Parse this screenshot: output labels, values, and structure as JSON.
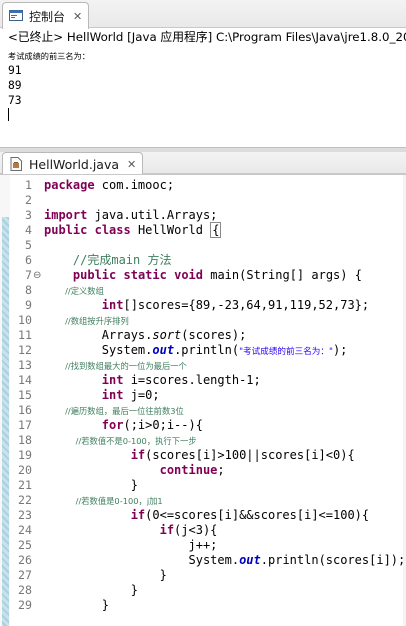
{
  "console": {
    "tab_label": "控制台",
    "tab_close": "✕",
    "status": "<已终止> HellWorld [Java 应用程序] C:\\Program Files\\Java\\jre1.8.0_20",
    "output_header": "考试成绩的前三名为：",
    "output_values": [
      "91",
      "89",
      "73"
    ]
  },
  "editor": {
    "tab_label": "HellWorld.java",
    "tab_close": "✕",
    "line_numbers": [
      "1",
      "2",
      "3",
      "4",
      "5",
      "6",
      "7",
      "8",
      "9",
      "10",
      "11",
      "12",
      "13",
      "14",
      "15",
      "16",
      "17",
      "18",
      "19",
      "20",
      "21",
      "22",
      "23",
      "24",
      "25",
      "26",
      "27",
      "28",
      "29"
    ],
    "fold_marker": "⊖",
    "lines": {
      "l1": [
        "package",
        " com.imooc;"
      ],
      "l3": [
        "import",
        " java.util.Arrays;"
      ],
      "l4": [
        "public",
        " ",
        "class",
        " HellWorld ",
        "{"
      ],
      "l6": [
        "    //完成main 方法"
      ],
      "l7": [
        "    ",
        "public",
        " ",
        "static",
        " ",
        "void",
        " main(String[] args) {"
      ],
      "l8": [
        "        //定义数组"
      ],
      "l9": [
        "        ",
        "int",
        "[]scores={89,-23,64,91,119,52,73};"
      ],
      "l10": [
        "        //数组按升序排列"
      ],
      "l11": [
        "        Arrays.",
        "sort",
        "(scores);"
      ],
      "l12": [
        "        System.",
        "out",
        ".println(",
        "\"考试成绩的前三名为：\"",
        ");"
      ],
      "l13": [
        "        //找到数组最大的一位为最后一个"
      ],
      "l14": [
        "        ",
        "int",
        " i=scores.length-1;"
      ],
      "l15": [
        "        ",
        "int",
        " j=0;"
      ],
      "l16": [
        "        //遍历数组，最后一位往前数3位"
      ],
      "l17": [
        "        ",
        "for",
        "(;i>0;i--){"
      ],
      "l18": [
        "            //若数值不是0-100，执行下一步"
      ],
      "l19": [
        "            ",
        "if",
        "(scores[i]>100||scores[i]<0){"
      ],
      "l20": [
        "                ",
        "continue",
        ";"
      ],
      "l21": [
        "            }"
      ],
      "l22": [
        "            //若数值是0-100，j加1"
      ],
      "l23": [
        "            ",
        "if",
        "(0<=scores[i]&&scores[i]<=100){"
      ],
      "l24": [
        "                ",
        "if",
        "(j<3){"
      ],
      "l25": [
        "                    j++;"
      ],
      "l26": [
        "                    System.",
        "out",
        ".println(scores[i]);"
      ],
      "l27": [
        "                }"
      ],
      "l28": [
        "            }"
      ],
      "l29": [
        "        }"
      ]
    }
  }
}
